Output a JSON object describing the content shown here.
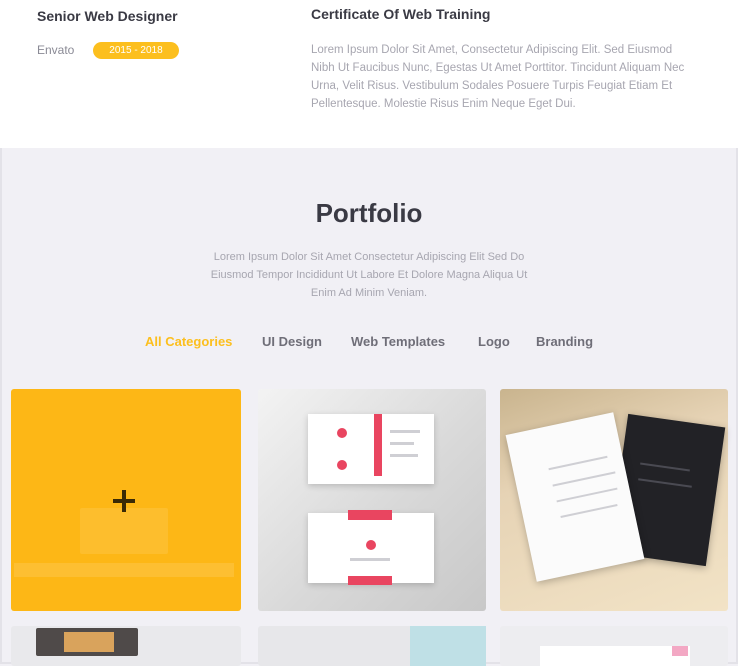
{
  "resume": {
    "job_title": "Senior Web Designer",
    "company": "Envato",
    "date": "2015 - 2018",
    "cert_title": "Certificate Of Web Training",
    "cert_desc": "Lorem Ipsum Dolor Sit Amet, Consectetur Adipiscing Elit. Sed Eiusmod Nibh Ut Faucibus Nunc, Egestas Ut Amet Porttitor. Tincidunt Aliquam Nec Urna, Velit Risus. Vestibulum Sodales Posuere Turpis Feugiat Etiam Et Pellentesque. Molestie Risus Enim Neque Eget Dui."
  },
  "portfolio": {
    "title": "Portfolio",
    "description": "Lorem Ipsum Dolor Sit Amet Consectetur Adipiscing Elit Sed Do Eiusmod Tempor Incididunt Ut Labore Et Dolore Magna Aliqua Ut Enim Ad Minim Veniam.",
    "filters": [
      "All Categories",
      "UI Design",
      "Web Templates",
      "Logo",
      "Branding"
    ],
    "active_filter": "All Categories"
  },
  "colors": {
    "accent": "#fcbf1e",
    "background": "#f1f0f5",
    "card_red": "#e94560"
  }
}
